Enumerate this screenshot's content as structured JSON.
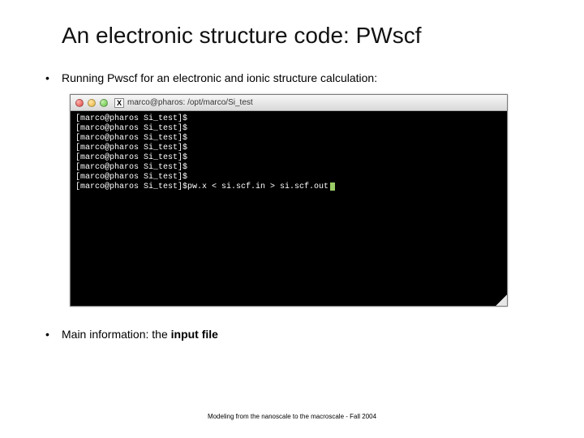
{
  "title": "An electronic structure code: PWscf",
  "bullets": {
    "b1": "Running Pwscf for an electronic and ionic structure calculation:",
    "b2_prefix": "Main information: the ",
    "b2_bold": "input file"
  },
  "terminal": {
    "title": "marco@pharos: /opt/marco/Si_test",
    "prompt": "[marco@pharos Si_test]$",
    "lines": [
      "",
      "",
      "",
      "",
      "",
      "",
      "",
      "pw.x < si.scf.in > si.scf.out"
    ]
  },
  "footer": "Modeling from the nanoscale to the macroscale - Fall 2004"
}
